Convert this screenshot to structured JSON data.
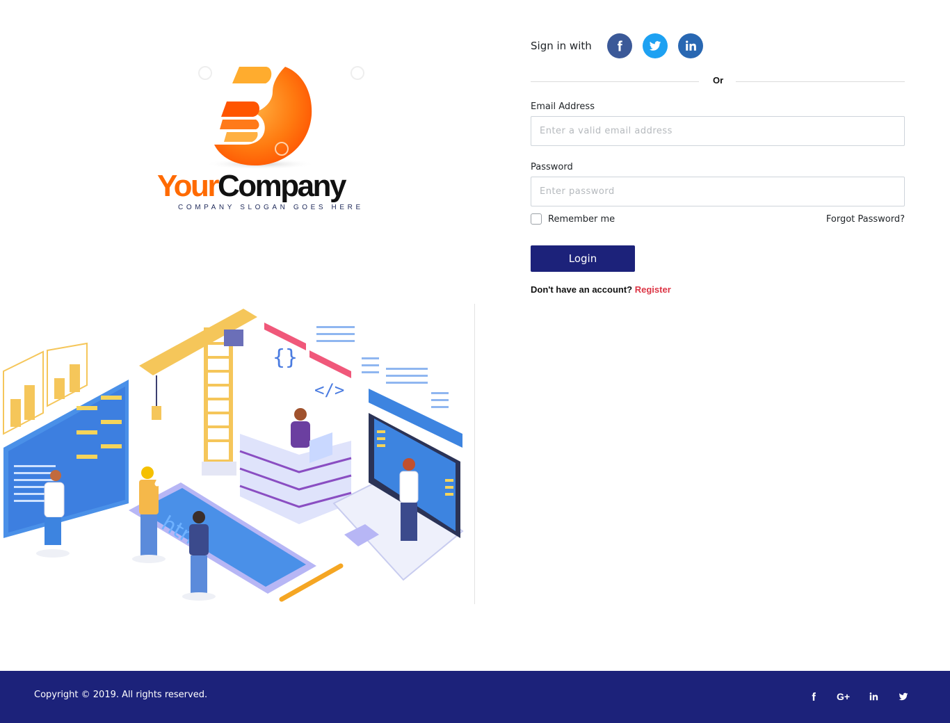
{
  "brand": {
    "name_part1": "Your",
    "name_part2": "Company",
    "slogan": "COMPANY SLOGAN GOES HERE",
    "colors": {
      "orange": "#ff6a00",
      "dark": "#111111",
      "primary": "#1c227a",
      "accent_red": "#dc3545"
    }
  },
  "illustration": {
    "description": "isometric web development team illustration",
    "icon": "web-development-illustration"
  },
  "social_signin": {
    "label": "Sign in with",
    "providers": [
      {
        "name": "Facebook",
        "icon": "facebook-icon",
        "color": "#3b5998"
      },
      {
        "name": "Twitter",
        "icon": "twitter-icon",
        "color": "#1da1f2"
      },
      {
        "name": "LinkedIn",
        "icon": "linkedin-icon",
        "color": "#2867b2"
      }
    ]
  },
  "separator": {
    "text": "Or"
  },
  "form": {
    "email": {
      "label": "Email Address",
      "value": "",
      "placeholder": "Enter a valid email address"
    },
    "password": {
      "label": "Password",
      "value": "",
      "placeholder": "Enter password"
    },
    "remember_me": {
      "label": "Remember me",
      "checked": false
    },
    "forgot_password": "Forgot Password?",
    "login_button": "Login",
    "register_prompt": "Don't have an account?",
    "register_link": "Register"
  },
  "footer": {
    "copyright": "Copyright © 2019. All rights reserved.",
    "social": [
      {
        "name": "Facebook",
        "icon": "facebook-icon"
      },
      {
        "name": "Google Plus",
        "icon": "google-plus-icon",
        "glyph": "G+"
      },
      {
        "name": "LinkedIn",
        "icon": "linkedin-icon"
      },
      {
        "name": "Twitter",
        "icon": "twitter-icon"
      }
    ]
  }
}
